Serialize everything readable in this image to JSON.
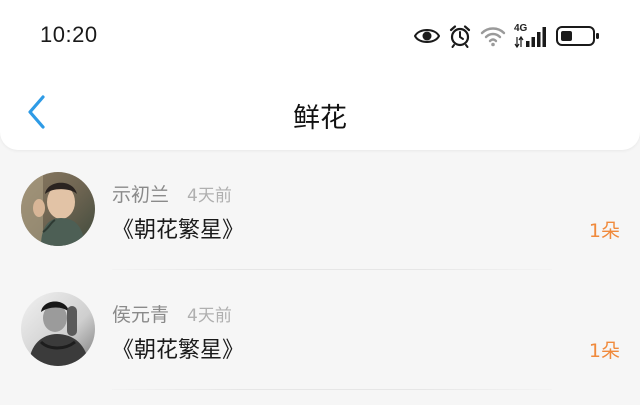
{
  "status_bar": {
    "time": "10:20",
    "network_label": "4G",
    "icons": [
      "eye-icon",
      "alarm-icon",
      "wifi-icon",
      "signal-4g-icon",
      "battery-icon"
    ]
  },
  "nav": {
    "back_icon": "chevron-left-icon",
    "title": "鲜花",
    "accent_color": "#2e9be6"
  },
  "flowers": {
    "count_color": "#f08a3c",
    "items": [
      {
        "user": "示初兰",
        "time": "4天前",
        "book": "《朝花繁星》",
        "count": "1朵"
      },
      {
        "user": "侯元青",
        "time": "4天前",
        "book": "《朝花繁星》",
        "count": "1朵"
      }
    ]
  }
}
